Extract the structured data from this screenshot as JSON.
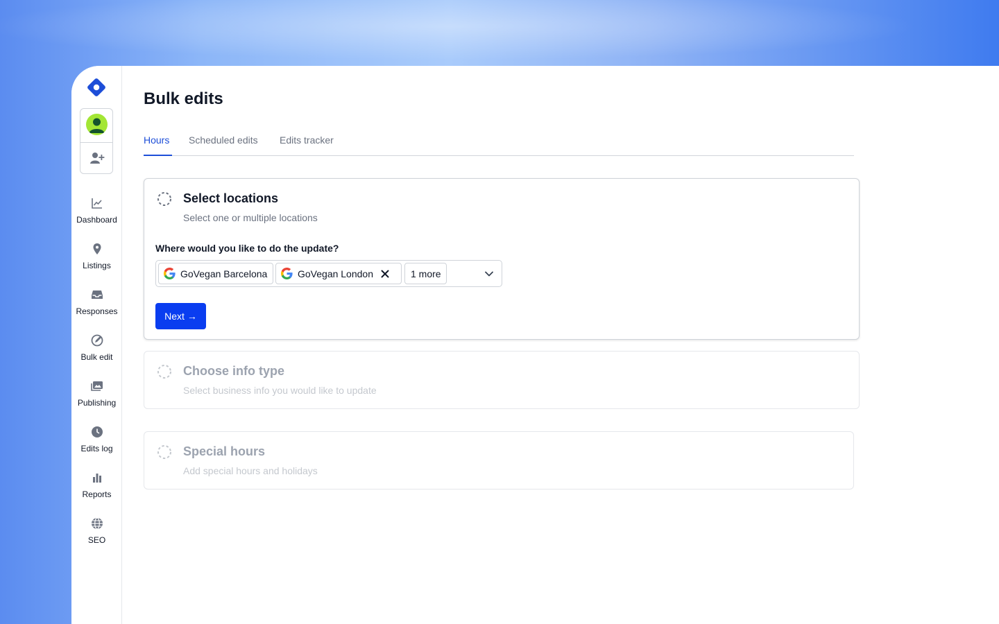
{
  "sidebar": {
    "items": [
      {
        "label": "Dashboard",
        "icon": "chart-line-icon"
      },
      {
        "label": "Listings",
        "icon": "map-pin-icon"
      },
      {
        "label": "Responses",
        "icon": "inbox-icon"
      },
      {
        "label": "Bulk edit",
        "icon": "bulk-edit-icon"
      },
      {
        "label": "Publishing",
        "icon": "images-icon"
      },
      {
        "label": "Edits log",
        "icon": "clock-icon"
      },
      {
        "label": "Reports",
        "icon": "bar-chart-icon"
      },
      {
        "label": "SEO",
        "icon": "globe-icon"
      }
    ]
  },
  "page": {
    "title": "Bulk edits",
    "tabs": [
      {
        "label": "Hours"
      },
      {
        "label": "Scheduled edits"
      },
      {
        "label": "Edits tracker"
      }
    ]
  },
  "steps": {
    "select_locations": {
      "title": "Select locations",
      "subtitle": "Select one or multiple locations",
      "question": "Where would you like to do the update?",
      "chips": [
        {
          "label": "GoVegan Barcelona"
        },
        {
          "label": "GoVegan London"
        }
      ],
      "more_label": "1 more",
      "next_label": "Next →"
    },
    "choose_info_type": {
      "title": "Choose info type",
      "subtitle": "Select business info you would like to update"
    },
    "special_hours": {
      "title": "Special hours",
      "subtitle": "Add special hours and holidays"
    }
  },
  "colors": {
    "accent": "#1d4ed8",
    "primary_button": "#0a3df0",
    "logo": "#1d4ed8",
    "avatar_bg": "#a3e635"
  }
}
